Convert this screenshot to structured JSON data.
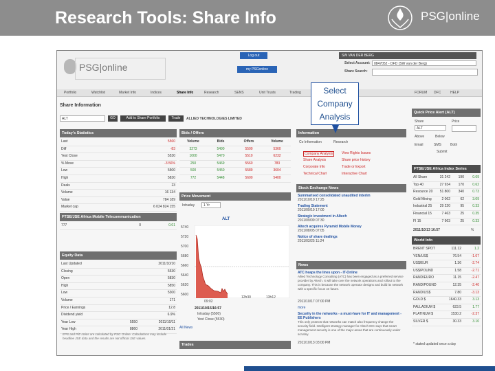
{
  "slide": {
    "title": "Research Tools: Share Info",
    "logo_text": "PSG|online",
    "accent": "#1f4f8f"
  },
  "callout": {
    "line1": "Select",
    "line2": "Company",
    "line3": "Analysis"
  },
  "screenshot": {
    "logo_text": "PSG|online",
    "buttons": {
      "log_out": "Log out",
      "my_psg": "my PSGonline"
    },
    "account": {
      "name": "SW VAN DER BERG",
      "select_account_label": "Select Account:",
      "select_account_value": "0847052 - DFD (SW van der Berg)",
      "share_search_label": "Share Search:"
    },
    "nav": [
      "Portfolio",
      "Watchlist",
      "Market Info",
      "Indices",
      "Share Info",
      "Research",
      "SENS",
      "Unit Trusts",
      "Trading",
      "FORUM",
      "DFC",
      "HELP"
    ],
    "share_info": {
      "title": "Share Information",
      "code": "ALT",
      "go": "GO",
      "add_portfolio": "Add to Share Portfolio",
      "trade": "Trade",
      "company": "ALLIED TECHNOLOGIES LIMITED"
    },
    "todays_stats": {
      "title": "Today's Statistics",
      "rows": [
        [
          "Last",
          "5560"
        ],
        [
          "Diff",
          "-83"
        ],
        [
          "Yest Close",
          "5530"
        ],
        [
          "% Move",
          "-3.56%"
        ],
        [
          "Low",
          "5500"
        ],
        [
          "High",
          "5830"
        ],
        [
          "Deals",
          "23"
        ],
        [
          "Volume",
          "16 134"
        ],
        [
          "Value",
          "784 189"
        ],
        [
          "Market cap",
          "6 024 824 155"
        ]
      ]
    },
    "sector": {
      "title": "FTSE/JSE Africa Mobile Telecommunication",
      "row": [
        "777",
        "0",
        "0.01"
      ]
    },
    "equity": {
      "title": "Equity Data",
      "rows": [
        [
          "Last Updated",
          "2011/10/10"
        ],
        [
          "Closing",
          "5530"
        ],
        [
          "Open",
          "5830"
        ],
        [
          "High",
          "5850"
        ],
        [
          "Low",
          "5300"
        ],
        [
          "Volume",
          "171"
        ],
        [
          "Price / Earnings",
          "12.8"
        ],
        [
          "Dividend yield",
          "6.9%"
        ],
        [
          "Year Low",
          "5550",
          "2011/10/11"
        ],
        [
          "Year High",
          "8860",
          "2011/01/21"
        ]
      ],
      "note": "EPS and P/E ratios are calculated by PSG Online. Calculations may include headline JSE data and the results are not official JSE values."
    },
    "bids_offers": {
      "title": "Bids / Offers",
      "headers": [
        "Volume",
        "Bids",
        "Offers",
        "Volume"
      ],
      "rows": [
        [
          "3273",
          "5490",
          "5500",
          "5360"
        ],
        [
          "1000",
          "5470",
          "5510",
          "6232"
        ],
        [
          "250",
          "5469",
          "5560",
          "783"
        ],
        [
          "500",
          "5450",
          "5589",
          "3604"
        ],
        [
          "772",
          "5448",
          "5600",
          "5400"
        ]
      ]
    },
    "price_movement": {
      "title": "Price Movement",
      "tab": "Intraday",
      "period": "1 Yr",
      "chart_title": "ALT",
      "y_ticks": [
        "5740",
        "5720",
        "5700",
        "5680",
        "5660",
        "5640",
        "5620",
        "5600"
      ],
      "x_ticks": [
        "09:02",
        "12h30",
        "13h12"
      ],
      "legend_time": "2011/10/15/16:57",
      "legend_intraday": "Intraday (5500)",
      "legend_yest": "Yest Close (5530)",
      "all_news": "All News",
      "more": "more"
    },
    "company_info": {
      "title": "Information",
      "tabs": [
        "Co Information",
        "Research"
      ],
      "links_left": [
        "Company Analysis",
        "Share Analysis",
        "Corporate Info",
        "Technical Chart"
      ],
      "links_right": [
        "View Rights Issues",
        "Share price history",
        "Trade or Export",
        "Interactive Chart"
      ]
    },
    "sens": {
      "title": "Stock Exchange News",
      "items": [
        [
          "Summarised consolidated unaudited interim",
          "2011/10/10 17:25"
        ],
        [
          "Trading Statement",
          "2011/09/19 17:00"
        ],
        [
          "Strategic investment in Altech",
          "2011/09/09 07:30"
        ],
        [
          "Altech acquires Pyramid Mobile Money",
          "2011/08/05 07:05"
        ],
        [
          "Notice of share dealings",
          "2011/03/25 11:24"
        ]
      ]
    },
    "news": {
      "title": "News",
      "items": [
        [
          "ATC heaps the lines upon - IT-Online",
          "Allied Technology Consulting (ATC) has been engaged as a preferred service provider by Altech. It will take over the network operations and rollout to the company. This is because the network operator designs and build its network with a specific focus on future.",
          "2011/10/17 07:00 PM"
        ],
        [
          "Security in the networks - a must-have for IT and management - EE Publishers",
          "This only protects that networks can match also frequency change the security field. Intelligent strategy manager for Altech IDC says that smart management security is one of the major areas that are continuously under scrutiny.",
          "2011/10/13 03:00 PM"
        ]
      ]
    },
    "trades": {
      "title": "Trades"
    },
    "quick_alert": {
      "title": "Quick Price Alert (ALT)",
      "share_label": "Share",
      "price_label": "Price",
      "share_value": "ALT",
      "options": [
        "Above",
        "Below",
        "Email",
        "SMS",
        "Both"
      ],
      "submit": "Submit"
    },
    "indices": {
      "title": "FTSE/JSE Africa Index Series",
      "rows": [
        [
          "All Share",
          "31 242",
          "190",
          "0.69"
        ],
        [
          "Top 40",
          "27 934",
          "170",
          "0.62"
        ],
        [
          "Resource 20",
          "51 800",
          "340",
          "0.73"
        ],
        [
          "Gold Mining",
          "2 062",
          "62",
          "3.09"
        ],
        [
          "Industrial 25",
          "29 220",
          "95",
          "0.33"
        ],
        [
          "Financial 15",
          "7 463",
          "25",
          "0.35"
        ],
        [
          "FI 15",
          "7 963",
          "25",
          "0.33"
        ]
      ],
      "time": "2011/10/13 16:57",
      "pct": "%"
    },
    "world": {
      "title": "World Info",
      "rows": [
        [
          "BRENT SPOT",
          "111.12",
          "1.2",
          "green"
        ],
        [
          "YEN/US$",
          "76.54",
          "-1.07",
          "red"
        ],
        [
          "US$/EUR",
          "1.36",
          "-2.74",
          "red"
        ],
        [
          "US$/POUND",
          "1.58",
          "-2.71",
          "red"
        ],
        [
          "RAND/EURO",
          "11.15",
          "-2.47",
          "red"
        ],
        [
          "RAND/POUND",
          "12.35",
          "-2.40",
          "red"
        ],
        [
          "RAND/US$",
          "7.80",
          "-3.13",
          "red"
        ],
        [
          "GOLD $",
          "1640.33",
          "3.13",
          "green"
        ],
        [
          "PALLADIUM $",
          "623.5",
          "1.77",
          "green"
        ],
        [
          "PLATINUM $",
          "1530.2",
          "-2.37",
          "red"
        ],
        [
          "SILVER $",
          "30.33",
          "3.10",
          "green"
        ]
      ],
      "footnote": "* stated updated once a day"
    }
  }
}
